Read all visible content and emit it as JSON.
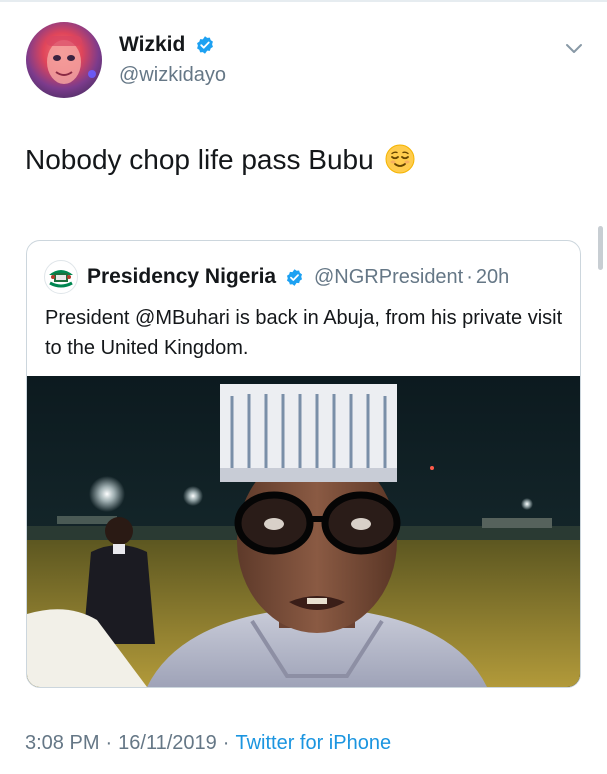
{
  "tweet": {
    "author": {
      "name": "Wizkid",
      "handle": "@wizkidayo",
      "verified": true
    },
    "text": "Nobody chop life pass Bubu",
    "emoji_icon": "relieved-face-icon",
    "timestamp": {
      "time": "3:08 PM",
      "date": "16/11/2019",
      "source": "Twitter for iPhone"
    }
  },
  "quoted_tweet": {
    "author": {
      "name": "Presidency Nigeria",
      "handle": "@NGRPresident",
      "verified": true
    },
    "separator": "·",
    "age": "20h",
    "text": "President @MBuhari is back in Abuja, from his private visit to the United Kingdom."
  },
  "separator": "·",
  "colors": {
    "text_primary": "#14171a",
    "text_secondary": "#657786",
    "link": "#1b95e0",
    "verified_badge": "#1da1f2",
    "card_border": "#ccd6dd"
  }
}
